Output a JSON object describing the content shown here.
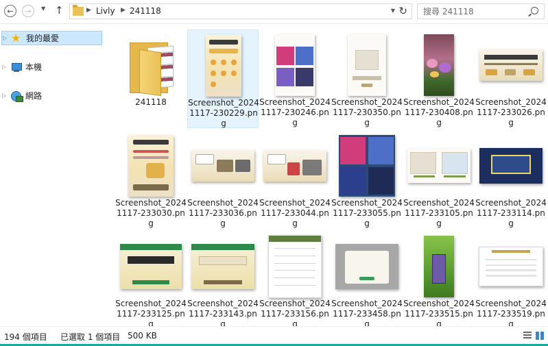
{
  "window": {
    "breadcrumbs": [
      "Livly",
      "241118"
    ],
    "search_placeholder": "搜尋 241118"
  },
  "nav": {
    "items": [
      {
        "label": "我的最愛",
        "icon": "star-icon",
        "selected": true
      },
      {
        "label": "本機",
        "icon": "computer-icon",
        "selected": false
      },
      {
        "label": "網路",
        "icon": "network-icon",
        "selected": false
      }
    ]
  },
  "files": [
    {
      "name": "241118",
      "type": "folder"
    },
    {
      "name": "Screenshot_20241117-230229.png",
      "type": "image",
      "thumb": "cream-portrait",
      "selected": true
    },
    {
      "name": "Screenshot_20241117-230246.png",
      "type": "image",
      "thumb": "game-portrait"
    },
    {
      "name": "Screenshot_20241117-230350.png",
      "type": "image",
      "thumb": "white-portrait"
    },
    {
      "name": "Screenshot_20241117-230408.png",
      "type": "image",
      "thumb": "forest-portrait"
    },
    {
      "name": "Screenshot_20241117-233026.png",
      "type": "image",
      "thumb": "banner-landscape"
    },
    {
      "name": "Screenshot_20241117-233030.png",
      "type": "image",
      "thumb": "cream-portrait"
    },
    {
      "name": "Screenshot_20241117-233036.png",
      "type": "image",
      "thumb": "banner-landscape"
    },
    {
      "name": "Screenshot_20241117-233044.png",
      "type": "image",
      "thumb": "banner-landscape"
    },
    {
      "name": "Screenshot_20241117-233055.png",
      "type": "image",
      "thumb": "game-square"
    },
    {
      "name": "Screenshot_20241117-233105.png",
      "type": "image",
      "thumb": "white-landscape"
    },
    {
      "name": "Screenshot_20241117-233114.png",
      "type": "image",
      "thumb": "blue-landscape"
    },
    {
      "name": "Screenshot_20241117-233125.png",
      "type": "image",
      "thumb": "gift-landscape"
    },
    {
      "name": "Screenshot_20241117-233143.png",
      "type": "image",
      "thumb": "gift-landscape"
    },
    {
      "name": "Screenshot_20241117-233156.png",
      "type": "image",
      "thumb": "list-portrait"
    },
    {
      "name": "Screenshot_20241117-233458.png",
      "type": "image",
      "thumb": "modal-landscape"
    },
    {
      "name": "Screenshot_20241117-233515.png",
      "type": "image",
      "thumb": "green-portrait"
    },
    {
      "name": "Screenshot_20241117-233519.png",
      "type": "image",
      "thumb": "profile-landscape"
    }
  ],
  "status": {
    "item_count": "194 個項目",
    "selection": "已選取 1 個項目",
    "size": "500 KB"
  },
  "colors": {
    "selection_bg": "#cce8ff",
    "tile_selected_bg": "#e5f3ff",
    "accent_bar": "#18a8a0"
  }
}
